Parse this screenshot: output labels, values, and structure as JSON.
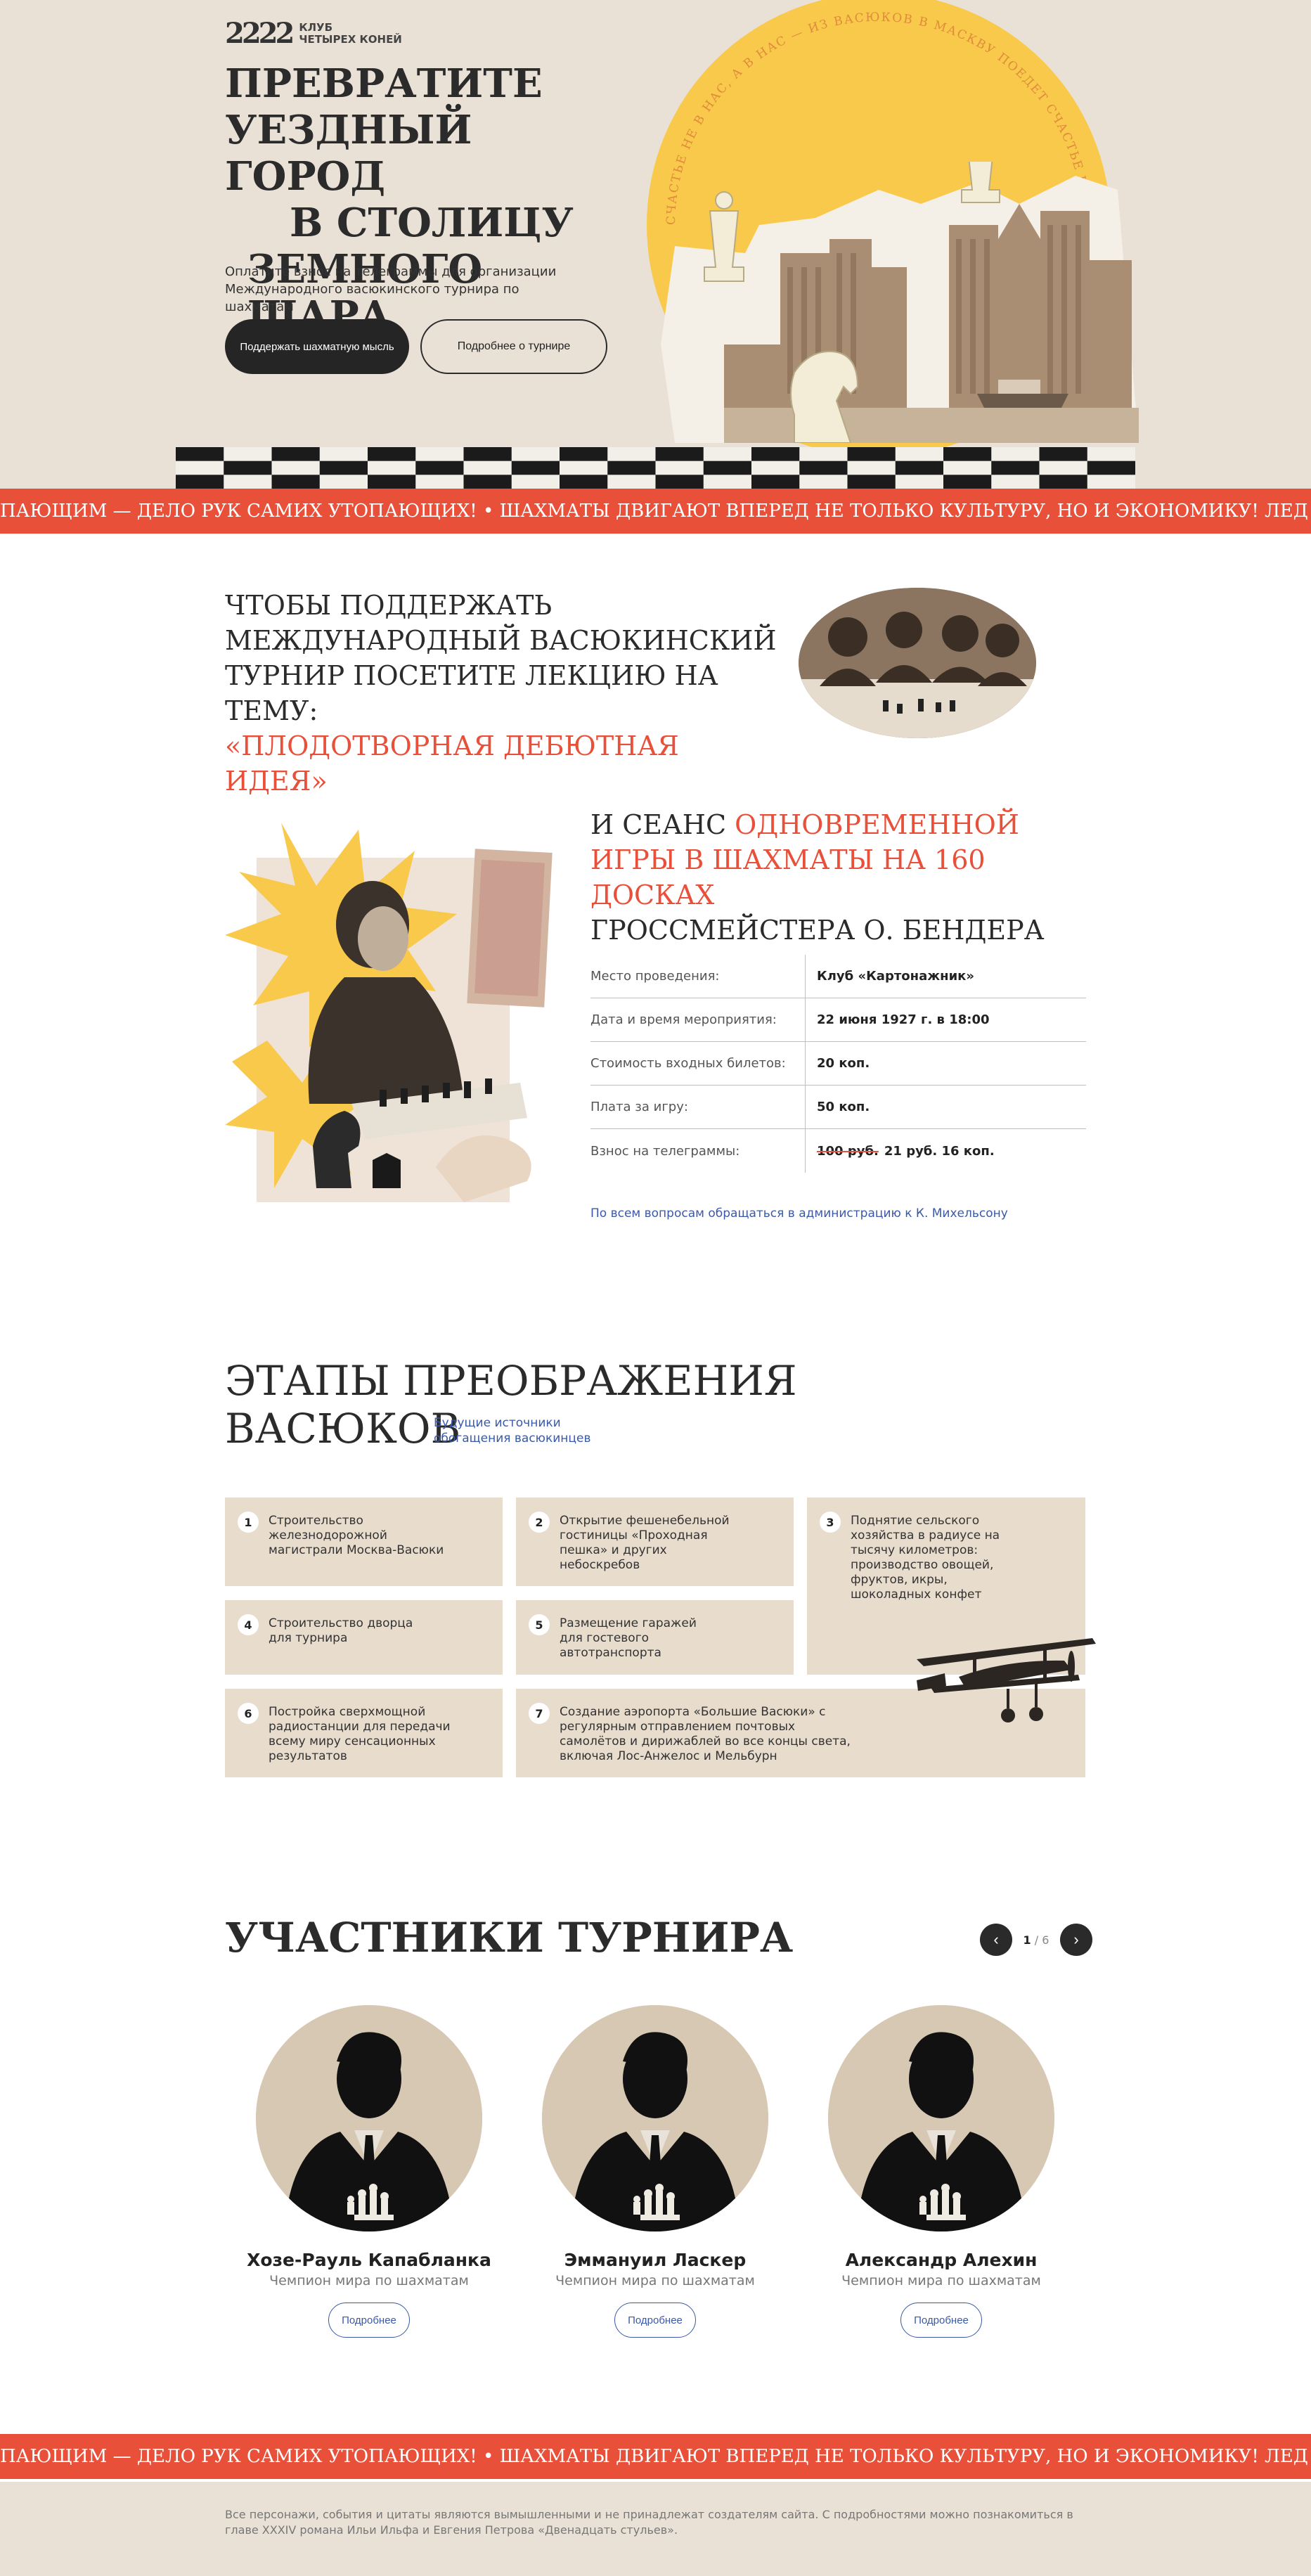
{
  "brand": {
    "logo_mark": "2222",
    "logo_line1": "Клуб",
    "logo_line2": "четырех коней"
  },
  "hero": {
    "title_lines": [
      "Превратите",
      "уездный город",
      "в столицу",
      "земного шара"
    ],
    "subtitle": "Оплатите взнос на телеграммы для организации Международного васюкинского турнира по шахматам",
    "primary_button": "Поддержать шахматную мысль",
    "secondary_button": "Подробнее о турнире",
    "ring_text": "СЧАСТЬЕ НЕ В НАС, А В НАС — ИЗ ВАСЮКОВ В МАСКВУ ПОЕДЕТ СЧАСТЬЕ НЕ В НАС"
  },
  "marquee": {
    "text": "ПАЮЩИМ — ДЕЛО РУК САМИХ УТОПАЮЩИХ!  •  ШАХМАТЫ ДВИГАЮТ ВПЕРЕД НЕ ТОЛЬКО КУЛЬТУРУ, НО И ЭКОНОМИКУ! ЛЕД  •  ТРОНУЛСЯ, ГОСПОДА ПРИСЯЖНЫЕ"
  },
  "lecture": {
    "text": "Чтобы поддержать Международный васюкинский турнир посетите лекцию на тему:",
    "accent": "«Плодотворная дебютная идея»"
  },
  "seance": {
    "prefix": "И сеанс ",
    "accent": "одновременной игры в шахматы на 160 досках",
    "suffix": "гроссмейстера О. Бендера",
    "rows": [
      {
        "key": "Место проведения:",
        "value": "Клуб «Картонажник»"
      },
      {
        "key": "Дата и время мероприятия:",
        "value": "22 июня 1927 г. в 18:00"
      },
      {
        "key": "Стоимость входных билетов:",
        "value": "20 коп."
      },
      {
        "key": "Плата за игру:",
        "value": "50 коп."
      },
      {
        "key": "Взнос на телеграммы:",
        "old_value": "100 руб.",
        "value": "21 руб. 16 коп."
      }
    ],
    "contact": "По всем вопросам обращаться в администрацию к К. Михельсону"
  },
  "stages": {
    "title_line1": "Этапы преображения",
    "title_line2": "Васюков",
    "note": "Будущие источники обогащения васюкинцев",
    "items": [
      {
        "num": "1",
        "text": "Строительство железнодорожной магистрали Москва-Васюки"
      },
      {
        "num": "2",
        "text": "Открытие фешенебельной гостиницы «Проходная пешка» и других небоскребов"
      },
      {
        "num": "3",
        "text": "Поднятие сельского хозяйства в радиусе на тысячу километров: производство овощей, фруктов, икры, шоколадных конфет"
      },
      {
        "num": "4",
        "text": "Строительство дворца для турнира"
      },
      {
        "num": "5",
        "text": "Размещение гаражей для гостевого автотранспорта"
      },
      {
        "num": "6",
        "text": "Постройка сверхмощной радиостанции для передачи всему миру сенсационных результатов"
      },
      {
        "num": "7",
        "text": "Создание аэропорта «Большие Васюки» с регулярным отправлением почтовых самолётов и дирижаблей во все концы света, включая Лос-Анжелос и Мельбурн"
      }
    ]
  },
  "participants": {
    "title": "Участники турнира",
    "page_current": "1",
    "page_sep": " / ",
    "page_total": "6",
    "more_label": "Подробнее",
    "cards": [
      {
        "name": "Хозе-Рауль Капабланка",
        "role": "Чемпион мира по шахматам"
      },
      {
        "name": "Эммануил Ласкер",
        "role": "Чемпион мира по шахматам"
      },
      {
        "name": "Александр Алехин",
        "role": "Чемпион мира по шахматам"
      }
    ]
  },
  "footer": {
    "text": "Все персонажи, события и цитаты являются вымышленными и не принадлежат создателям сайта. С подробностями можно познакомиться в главе XXXIV романа Ильи Ильфа и Евгения Петрова «Двенадцать стульев»."
  },
  "icons": {
    "prev": "chevron-left-icon",
    "next": "chevron-right-icon"
  },
  "colors": {
    "accent": "#e8503a",
    "sun": "#f9c94c",
    "beige": "#e9e1d6",
    "link": "#3a59a8",
    "dark": "#252525"
  }
}
